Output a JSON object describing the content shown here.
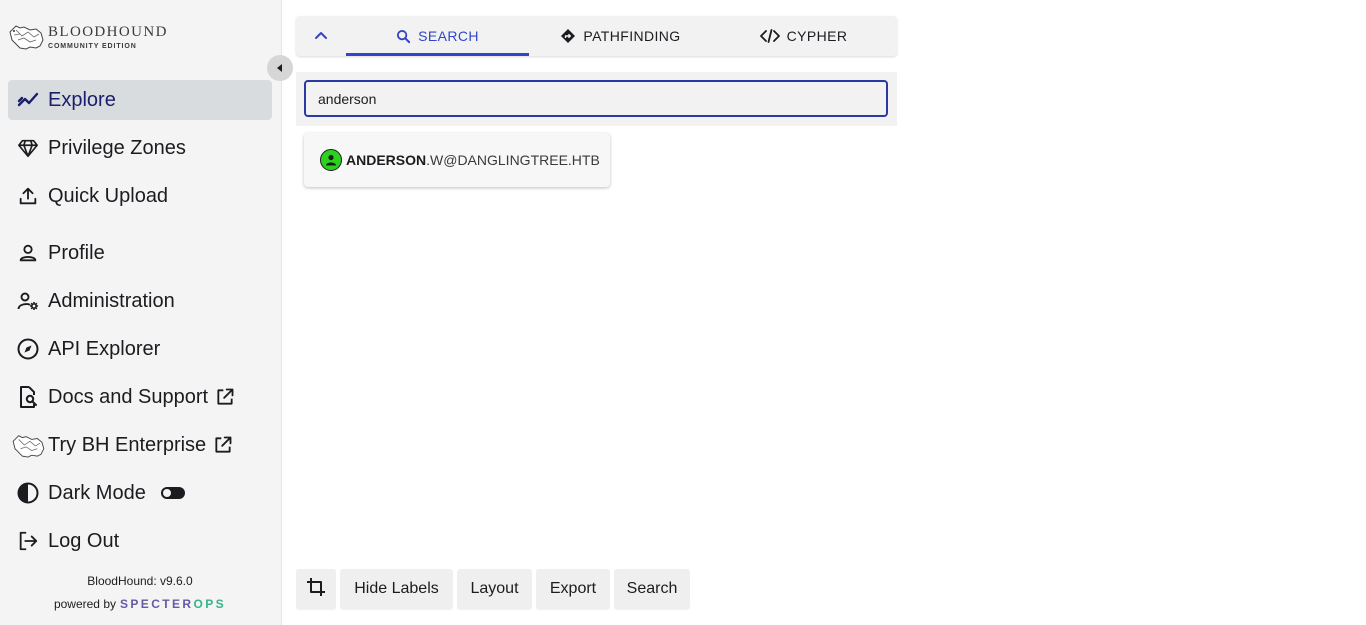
{
  "sidebar": {
    "brand": {
      "title": "BLOODHOUND",
      "subtitle": "COMMUNITY EDITION"
    },
    "items": [
      {
        "label": "Explore",
        "icon": "line-chart-icon",
        "active": true
      },
      {
        "label": "Privilege Zones",
        "icon": "gem-icon"
      },
      {
        "label": "Quick Upload",
        "icon": "upload-icon"
      },
      {
        "label": "Profile",
        "icon": "person-icon"
      },
      {
        "label": "Administration",
        "icon": "user-gear-icon"
      },
      {
        "label": "API Explorer",
        "icon": "compass-icon"
      },
      {
        "label": "Docs and Support",
        "icon": "doc-search-icon",
        "external": true
      },
      {
        "label": "Try BH Enterprise",
        "icon": "bloodhound-icon",
        "external": true
      },
      {
        "label": "Dark Mode",
        "icon": "contrast-icon",
        "toggle": "off"
      },
      {
        "label": "Log Out",
        "icon": "logout-icon"
      }
    ],
    "version": "BloodHound: v9.6.0",
    "powered_by": "powered by",
    "vendor": {
      "name_a": "SPECTER",
      "name_b": "OPS"
    }
  },
  "tabs": [
    {
      "label": "SEARCH",
      "icon": "search-icon",
      "active": true
    },
    {
      "label": "PATHFINDING",
      "icon": "diamond-direction-icon"
    },
    {
      "label": "CYPHER",
      "icon": "code-icon"
    }
  ],
  "search": {
    "value": "anderson",
    "placeholder": ""
  },
  "results": [
    {
      "match": "ANDERSON",
      "rest": ".W@DANGLINGTREE.HTB",
      "icon": "user-icon",
      "color": "#2bd11f"
    }
  ],
  "toolbar": {
    "hide_labels": "Hide Labels",
    "layout": "Layout",
    "export": "Export",
    "search": "Search"
  },
  "colors": {
    "accent": "#3446c7",
    "active_nav": "#d9dcdf",
    "user_node": "#2bd11f",
    "specter": "#6758a8",
    "ops": "#38b38b"
  }
}
